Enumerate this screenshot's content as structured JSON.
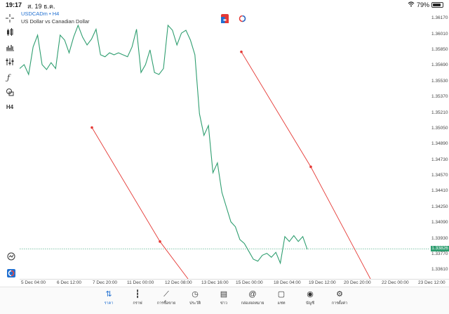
{
  "status_bar": {
    "time": "19:17",
    "date": "ส. 19 ธ.ค.",
    "battery": "79%"
  },
  "symbol": {
    "ticker": "USDCADm",
    "separator": "•",
    "timeframe": "H4",
    "description": "US Dollar vs Canadian Dollar"
  },
  "toolbar": {
    "items": [
      "crosshair-icon",
      "candlestick-icon",
      "bar-chart-icon",
      "indicator-icon",
      "function-icon",
      "shapes-icon"
    ],
    "timeframe_label": "H4"
  },
  "price_axis": {
    "labels": [
      "1.36170",
      "1.36010",
      "1.35850",
      "1.35690",
      "1.35530",
      "1.35370",
      "1.35210",
      "1.35050",
      "1.34890",
      "1.34730",
      "1.34570",
      "1.34410",
      "1.34250",
      "1.34090",
      "1.33930",
      "1.33770",
      "1.33610"
    ],
    "current_price": "1.33826"
  },
  "time_axis": {
    "labels": [
      "5 Dec 04:00",
      "6 Dec 12:00",
      "7 Dec 20:00",
      "11 Dec 00:00",
      "12 Dec 08:00",
      "13 Dec 16:00",
      "15 Dec 00:00",
      "18 Dec 04:00",
      "19 Dec 12:00",
      "20 Dec 20:00",
      "22 Dec 00:00",
      "23 Dec 12:00"
    ]
  },
  "colors": {
    "line": "#2f9e70",
    "trendline": "#e53935",
    "accent": "#1f6fd1",
    "current_price_bg": "#2f9e70"
  },
  "bottom_nav": {
    "items": [
      {
        "icon": "quotes-icon",
        "label": "ราคา",
        "active": true
      },
      {
        "icon": "chart-icon",
        "label": "กราฟ",
        "active": false
      },
      {
        "icon": "trade-icon",
        "label": "การซื้อขาย",
        "active": false
      },
      {
        "icon": "history-icon",
        "label": "ประวัติ",
        "active": false
      },
      {
        "icon": "news-icon",
        "label": "ข่าว",
        "active": false
      },
      {
        "icon": "mailbox-icon",
        "label": "กล่องจดหมาย",
        "active": false
      },
      {
        "icon": "chat-icon",
        "label": "แชท",
        "active": false
      },
      {
        "icon": "account-icon",
        "label": "บัญชี",
        "active": false
      },
      {
        "icon": "settings-icon",
        "label": "การตั้งค่า",
        "active": false
      }
    ]
  },
  "chart_data": {
    "type": "line",
    "title": "",
    "ylim": [
      1.3352,
      1.3625
    ],
    "series": [
      {
        "values": [
          1.3566,
          1.357,
          1.356,
          1.3588,
          1.36,
          1.357,
          1.3565,
          1.3572,
          1.3566,
          1.36,
          1.3595,
          1.3582,
          1.3598,
          1.361,
          1.3598,
          1.359,
          1.3596,
          1.3606,
          1.358,
          1.3578,
          1.3582,
          1.358,
          1.3582,
          1.358,
          1.3578,
          1.3588,
          1.3606,
          1.3562,
          1.357,
          1.3585,
          1.3562,
          1.356,
          1.3566,
          1.361,
          1.3605,
          1.359,
          1.3602,
          1.3605,
          1.3595,
          1.358,
          1.352,
          1.3498,
          1.3508,
          1.346,
          1.347,
          1.344,
          1.3425,
          1.341,
          1.3405,
          1.3392,
          1.3388,
          1.338,
          1.3372,
          1.337,
          1.3376,
          1.3378,
          1.3374,
          1.3379,
          1.3368,
          1.3395,
          1.339,
          1.3396,
          1.339,
          1.3395,
          1.3382
        ]
      }
    ],
    "trendlines": [
      {
        "points": [
          [
            1.3506
          ],
          [
            1.339
          ],
          [
            1.3352
          ]
        ]
      },
      {
        "points": [
          [
            1.3583
          ],
          [
            1.3466
          ],
          [
            1.3352
          ]
        ]
      }
    ]
  }
}
